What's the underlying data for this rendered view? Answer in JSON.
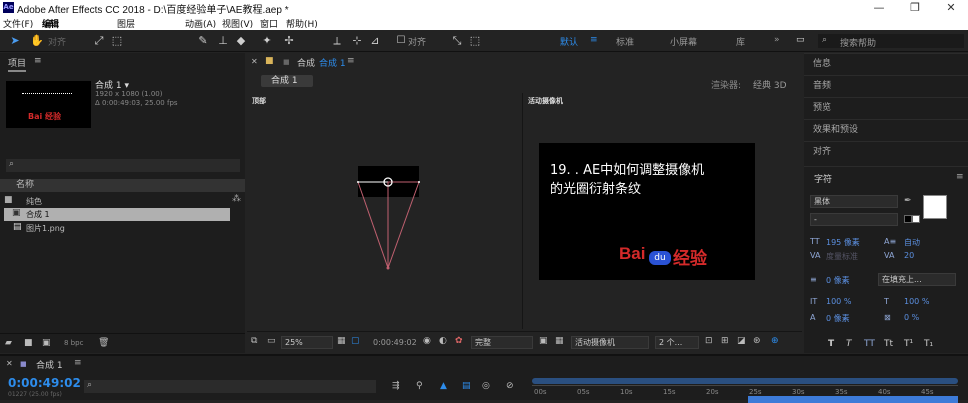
{
  "titlebar": {
    "title": "Adobe After Effects CC 2018 - D:\\百度经验单子\\AE教程.aep *",
    "minimize": "—",
    "restore": "❐",
    "close": "✕"
  },
  "menubar": {
    "items": [
      "文件(F)",
      "编辑",
      "图层",
      "动画(A)",
      "视图(V)",
      "窗口",
      "帮助(H)"
    ]
  },
  "toolbar": {
    "align_label": "对齐",
    "align2_label": "对齐",
    "workspaces": [
      "默认",
      "标准",
      "小屏幕",
      "库"
    ],
    "search_placeholder": "搜索帮助"
  },
  "project": {
    "tab": "项目",
    "comp_name": "合成 1 ▾",
    "comp_size": "1920 x 1080 (1.00)",
    "comp_duration": "Δ 0:00:49:03, 25.00 fps",
    "column_name": "名称",
    "items": [
      {
        "icon": "folder-icon",
        "name": "纯色"
      },
      {
        "icon": "comp-icon",
        "name": "合成 1"
      },
      {
        "icon": "image-icon",
        "name": "图片1.png"
      }
    ],
    "bpc": "8 bpc"
  },
  "composition": {
    "tab_prefix": "合成",
    "tab_name": "合成 1",
    "subtab": "合成 1",
    "renderer_label": "渲染器:",
    "renderer_value": "经典 3D",
    "view_top": "顶部",
    "view_camera": "活动摄像机",
    "preview_text_line1": "19. . AE中如何调整摄像机",
    "preview_text_line2": "的光圈衍射条纹",
    "preview_logo_bai": "Bai",
    "preview_logo_du": "du",
    "preview_logo_jy": "经验",
    "thumb_logo": "Bai 经验",
    "zoom": "25%",
    "timecode": "0:00:49:02",
    "quality": "完整",
    "camera": "活动摄像机",
    "views": "2 个..."
  },
  "right_panel": {
    "items": [
      "信息",
      "音频",
      "预览",
      "效果和预设",
      "对齐"
    ],
    "character_tab": "字符",
    "font": "黑体",
    "font_style": "-",
    "size": "195 像素",
    "leading": "自动",
    "kerning": "度量标准",
    "tracking": "20",
    "stroke_width": "0 像素",
    "stroke_type": "在填充上...",
    "vscale": "100 %",
    "hscale": "100 %",
    "baseline": "0 像素",
    "tsume": "0 %",
    "style_buttons": [
      "T",
      "T",
      "TT",
      "Tt",
      "T¹",
      "T₁"
    ]
  },
  "timeline": {
    "tab": "合成 1",
    "timecode": "0:00:49:02",
    "frames": "01227 (25.00 fps)",
    "ruler": [
      "00s",
      "05s",
      "10s",
      "15s",
      "20s",
      "25s",
      "30s",
      "35s",
      "40s",
      "45s"
    ]
  },
  "colors": {
    "accent": "#2d8ceb",
    "logo_red": "#d42a2a",
    "logo_blue": "#2a52d4",
    "fill": "#ffffff",
    "stroke": "#1a1aa8"
  }
}
